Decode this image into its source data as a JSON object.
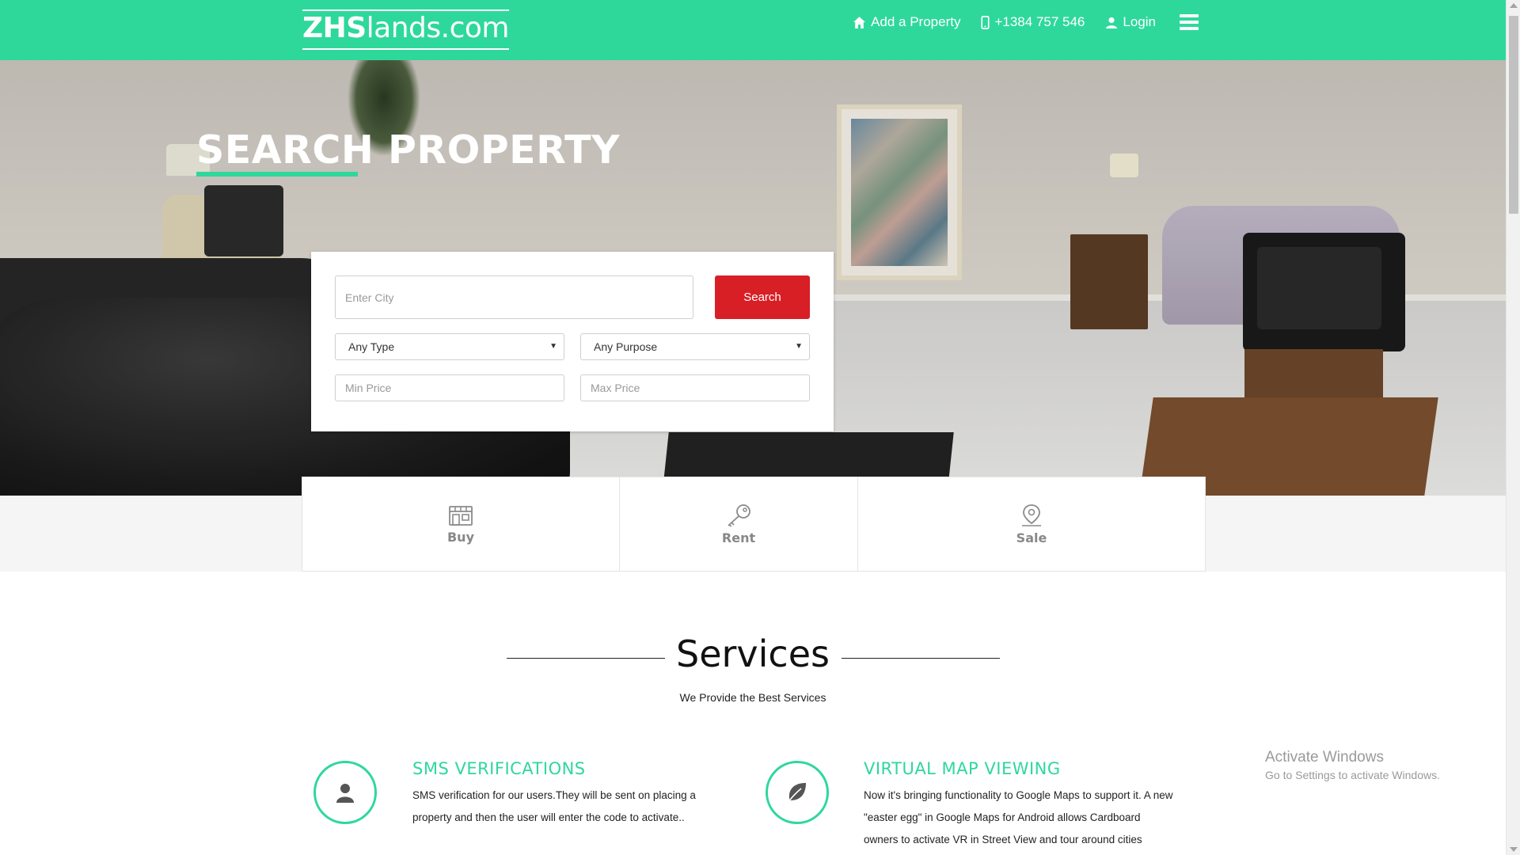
{
  "header": {
    "logo_bold": "ZHS",
    "logo_rest": "lands.com",
    "nav": {
      "add_property": "Add a Property",
      "phone": "+1384 757 546",
      "login": "Login"
    }
  },
  "hero": {
    "title_part1": "SEARCH",
    "title_part2": " PROPERTY"
  },
  "search": {
    "city_placeholder": "Enter City",
    "button_label": "Search",
    "type_select": "Any Type",
    "purpose_select": "Any Purpose",
    "min_price_placeholder": "Min Price",
    "max_price_placeholder": "Max Price"
  },
  "categories": [
    {
      "label": "Buy",
      "icon": "storefront-icon"
    },
    {
      "label": "Rent",
      "icon": "key-icon"
    },
    {
      "label": "Sale",
      "icon": "map-pin-icon"
    }
  ],
  "services": {
    "title": "Services",
    "subtitle": "We Provide the Best Services",
    "items": [
      {
        "title": "SMS VERIFICATIONS",
        "icon": "user-icon",
        "line1": "SMS verification for our users.They will be sent on placing a",
        "line2": "property and then the user will enter the code to activate.."
      },
      {
        "title": "VIRTUAL MAP VIEWING",
        "icon": "leaf-icon",
        "line1": "Now it's bringing functionality to Google Maps to support it. A new",
        "line2": "\"easter egg\" in Google Maps for Android allows Cardboard",
        "line3": "owners to activate VR in Street View and tour around cities"
      }
    ]
  },
  "watermark": {
    "line1": "Activate Windows",
    "line2": "Go to Settings to activate Windows."
  },
  "colors": {
    "brand": "#2ed89b",
    "search_button": "#d81f26"
  }
}
